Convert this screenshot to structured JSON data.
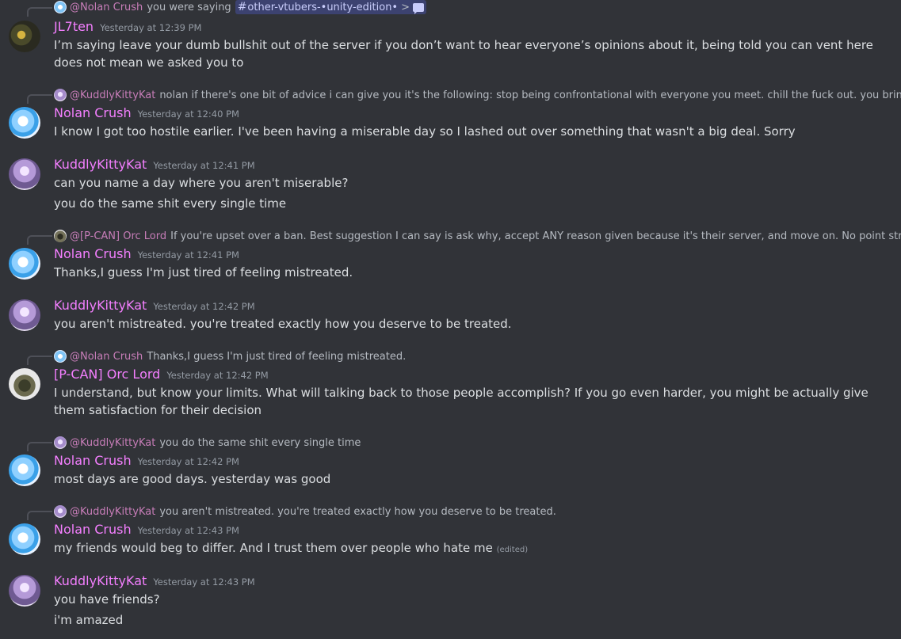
{
  "messages": [
    {
      "reply": {
        "name": "@Nolan Crush",
        "text": "you were saying",
        "channel": "other-vtubers-•unity-edition•",
        "jump": ">"
      },
      "author": "JL7ten",
      "author_color": "#f47fff",
      "timestamp": "Yesterday at 12:39 PM",
      "lines": [
        "I’m saying leave your dumb bullshit out of the server if you don’t want to hear everyone’s opinions about it, being told you can vent here does not mean we asked you to"
      ]
    },
    {
      "reply": {
        "name": "@KuddlyKittyKat",
        "text": "nolan if there's one bit of advice i can give you it's the following: stop being confrontational with everyone you meet. chill the fuck out. you bring all of this on"
      },
      "author": "Nolan Crush",
      "timestamp": "Yesterday at 12:40 PM",
      "lines": [
        "I know I got too hostile earlier. I've been having a miserable day so I lashed out over something that wasn't a big deal. Sorry"
      ]
    },
    {
      "author": "KuddlyKittyKat",
      "timestamp": "Yesterday at 12:41 PM",
      "lines": [
        "can you name a day where you aren't miserable?",
        "you do the same shit every single time"
      ]
    },
    {
      "reply": {
        "name": "@[P-CAN] Orc Lord",
        "text": "If you're upset over a ban. Best suggestion I can say is ask why, accept ANY reason given because it's their server, and move on. No point stressing"
      },
      "author": "Nolan Crush",
      "timestamp": "Yesterday at 12:41 PM",
      "lines": [
        "Thanks,I guess I'm just tired of feeling mistreated."
      ]
    },
    {
      "author": "KuddlyKittyKat",
      "timestamp": "Yesterday at 12:42 PM",
      "lines": [
        "you aren't mistreated. you're treated exactly how you deserve to be treated."
      ]
    },
    {
      "reply": {
        "name": "@Nolan Crush",
        "text": "Thanks,I guess I'm just tired of feeling mistreated."
      },
      "author": "[P-CAN] Orc Lord",
      "timestamp": "Yesterday at 12:42 PM",
      "lines": [
        "I understand, but know your limits. What will talking back to those people accomplish? If you go even harder, you might be actually give them satisfaction for their decision"
      ]
    },
    {
      "reply": {
        "name": "@KuddlyKittyKat",
        "text": "you do the same shit every single time"
      },
      "author": "Nolan Crush",
      "timestamp": "Yesterday at 12:42 PM",
      "lines": [
        "most days are good days. yesterday was good"
      ]
    },
    {
      "reply": {
        "name": "@KuddlyKittyKat",
        "text": "you aren't mistreated. you're treated exactly how you deserve to be treated."
      },
      "author": "Nolan Crush",
      "timestamp": "Yesterday at 12:43 PM",
      "lines": [
        "my friends would beg to differ. And I trust them over people who hate me"
      ],
      "edited": "(edited)"
    },
    {
      "author": "KuddlyKittyKat",
      "timestamp": "Yesterday at 12:43 PM",
      "lines": [
        "you have friends?",
        "i'm amazed"
      ]
    }
  ],
  "colors": {
    "background": "#313338",
    "username": "#f47fff",
    "timestamp": "#949ba4",
    "text": "#dbdee1",
    "reply_name": "#c77db8"
  }
}
